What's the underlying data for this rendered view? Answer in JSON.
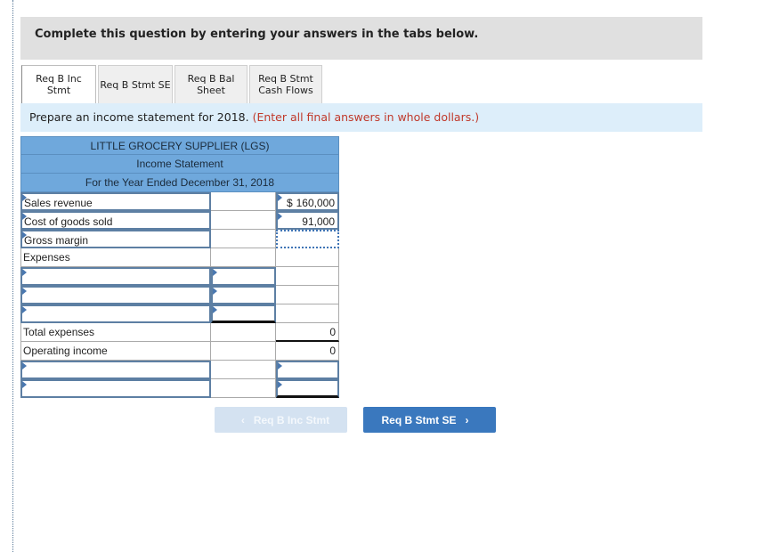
{
  "banner": {
    "text": "Complete this question by entering your answers in the tabs below."
  },
  "tabs": [
    {
      "label": "Req B Inc Stmt",
      "line1": "Req B Inc",
      "line2": "Stmt",
      "active": true
    },
    {
      "label": "Req B Stmt SE",
      "line1": "Req B Stmt SE",
      "line2": "",
      "active": false
    },
    {
      "label": "Req B Bal Sheet",
      "line1": "Req B Bal",
      "line2": "Sheet",
      "active": false
    },
    {
      "label": "Req B Stmt Cash Flows",
      "line1": "Req B Stmt",
      "line2": "Cash Flows",
      "active": false
    }
  ],
  "instructions": {
    "text": "Prepare an income statement for 2018.",
    "note": "(Enter all final answers in whole dollars.)"
  },
  "statement": {
    "company": "LITTLE GROCERY SUPPLIER (LGS)",
    "title": "Income Statement",
    "period": "For the Year Ended December 31, 2018",
    "rows": [
      {
        "label": "Sales revenue",
        "col2": "",
        "currency": "$",
        "col3": "160,000"
      },
      {
        "label": "Cost of goods sold",
        "col2": "",
        "col3": "91,000"
      },
      {
        "label": "Gross margin",
        "col2": "",
        "col3": ""
      },
      {
        "label": "Expenses",
        "col2": "",
        "col3": ""
      },
      {
        "label": "",
        "col2": "",
        "col3": ""
      },
      {
        "label": "",
        "col2": "",
        "col3": ""
      },
      {
        "label": "",
        "col2": "",
        "col3": ""
      },
      {
        "label": "Total expenses",
        "col2": "",
        "col3": "0"
      },
      {
        "label": "Operating income",
        "col2": "",
        "col3": "0"
      },
      {
        "label": "",
        "col2": "",
        "col3": ""
      },
      {
        "label": "",
        "col2": "",
        "col3": ""
      }
    ]
  },
  "nav": {
    "prev_label": "Req B Inc Stmt",
    "prev_icon": "‹",
    "next_label": "Req B Stmt SE",
    "next_icon": "›"
  }
}
